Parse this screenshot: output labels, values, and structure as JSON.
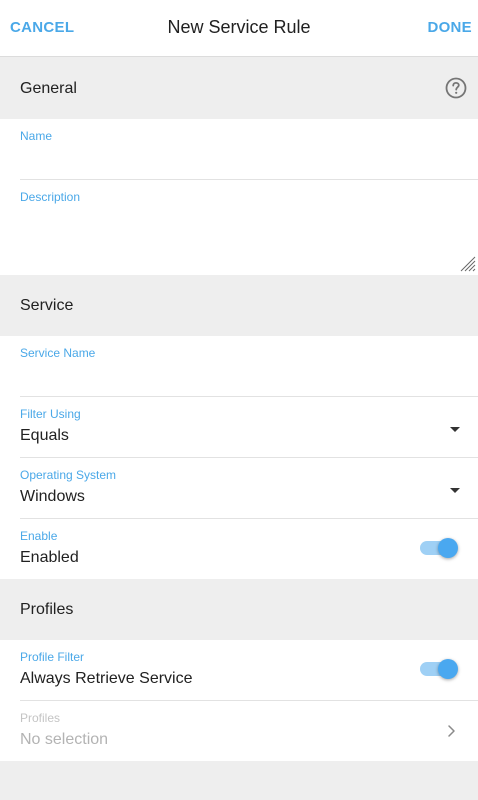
{
  "header": {
    "cancel_label": "CANCEL",
    "title": "New Service Rule",
    "done_label": "DONE"
  },
  "sections": {
    "general": "General",
    "service": "Service",
    "profiles": "Profiles"
  },
  "fields": {
    "name": {
      "label": "Name",
      "value": ""
    },
    "description": {
      "label": "Description",
      "value": ""
    },
    "service_name": {
      "label": "Service Name",
      "value": ""
    },
    "filter_using": {
      "label": "Filter Using",
      "value": "Equals"
    },
    "operating_system": {
      "label": "Operating System",
      "value": "Windows"
    },
    "enable": {
      "label": "Enable",
      "value": "Enabled",
      "toggle_on": true
    },
    "profile_filter": {
      "label": "Profile Filter",
      "value": "Always Retrieve Service",
      "toggle_on": true
    },
    "profiles": {
      "label": "Profiles",
      "value": "No selection"
    }
  },
  "icons": {
    "help": "help-circle-icon",
    "dropdown": "caret-down-icon",
    "chevron": "chevron-right-icon",
    "resize": "resize-handle-icon"
  },
  "colors": {
    "accent": "#4aa8e8",
    "toggle_track": "#9fd0f5",
    "toggle_thumb": "#4aa8f0",
    "section_bg": "#eeeeee",
    "disabled_text": "#b3b3b3"
  }
}
